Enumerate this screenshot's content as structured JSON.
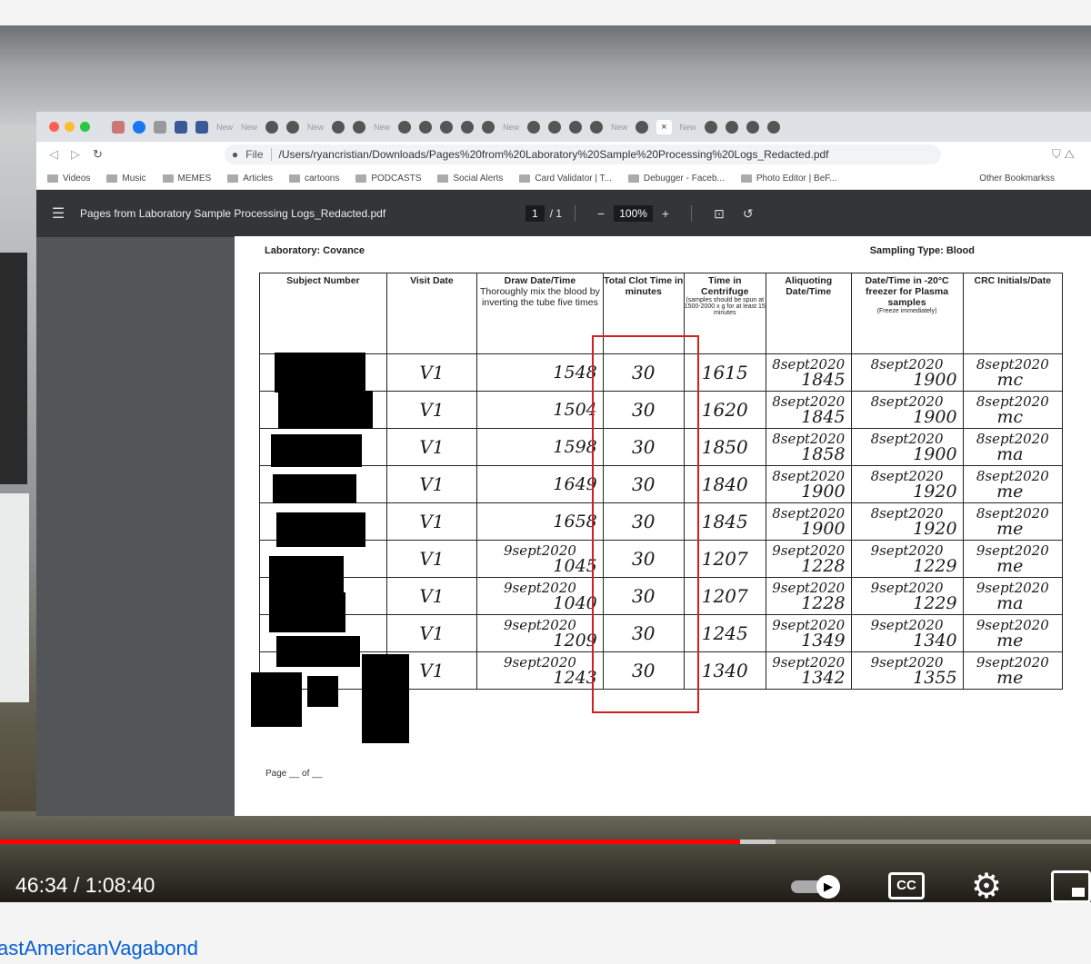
{
  "browser": {
    "active_tab_close": "×",
    "new_tab_label": "New",
    "url_scheme": "File",
    "url": "/Users/ryancristian/Downloads/Pages%20from%20Laboratory%20Sample%20Processing%20Logs_Redacted.pdf",
    "bookmarks": [
      "Videos",
      "Music",
      "MEMES",
      "Articles",
      "cartoons",
      "PODCASTS",
      "Social Alerts",
      "Card Validator | T...",
      "Debugger - Faceb...",
      "Photo Editor | BeF..."
    ],
    "other_bookmarks": "Other Bookmarkss"
  },
  "pdf": {
    "title": "Pages from Laboratory Sample Processing Logs_Redacted.pdf",
    "page_current": "1",
    "page_total": "/ 1",
    "zoom": "100%"
  },
  "doc": {
    "laboratory": "Laboratory: Covance",
    "sampling_type": "Sampling Type: Blood",
    "footer": "Page __ of __",
    "headers": {
      "subject": "Subject Number",
      "visit": "Visit Date",
      "draw": "Draw Date/Time",
      "draw_sub": "Thoroughly mix the blood by inverting the tube five times",
      "clot": "Total Clot Time in minutes",
      "centrifuge": "Time in Centrifuge",
      "centrifuge_sub": "(samples should be spun at 1500-2000 x g for at least 15 minutes",
      "aliquot": "Aliquoting Date/Time",
      "freezer": "Date/Time in -20°C freezer for Plasma samples",
      "freezer_sub": "(Freeze immediately)",
      "crc": "CRC Initials/Date"
    },
    "rows": [
      {
        "visit": "V1",
        "draw_date": "",
        "draw_time": "1548",
        "clot": "30",
        "centrifuge": "1615",
        "aliquot_date": "8sept2020",
        "aliquot_time": "1845",
        "freezer_date": "8sept2020",
        "freezer_time": "1900",
        "crc_date": "8sept2020",
        "crc_init": "mc"
      },
      {
        "visit": "V1",
        "draw_date": "",
        "draw_time": "1504",
        "clot": "30",
        "centrifuge": "1620",
        "aliquot_date": "8sept2020",
        "aliquot_time": "1845",
        "freezer_date": "8sept2020",
        "freezer_time": "1900",
        "crc_date": "8sept2020",
        "crc_init": "mc"
      },
      {
        "visit": "V1",
        "draw_date": "",
        "draw_time": "1598",
        "clot": "30",
        "centrifuge": "1850",
        "aliquot_date": "8sept2020",
        "aliquot_time": "1858",
        "freezer_date": "8sept2020",
        "freezer_time": "1900",
        "crc_date": "8sept2020",
        "crc_init": "ma"
      },
      {
        "visit": "V1",
        "draw_date": "",
        "draw_time": "1649",
        "clot": "30",
        "centrifuge": "1840",
        "aliquot_date": "8sept2020",
        "aliquot_time": "1900",
        "freezer_date": "8sept2020",
        "freezer_time": "1920",
        "crc_date": "8sept2020",
        "crc_init": "me"
      },
      {
        "visit": "V1",
        "draw_date": "",
        "draw_time": "1658",
        "clot": "30",
        "centrifuge": "1845",
        "aliquot_date": "8sept2020",
        "aliquot_time": "1900",
        "freezer_date": "8sept2020",
        "freezer_time": "1920",
        "crc_date": "8sept2020",
        "crc_init": "me"
      },
      {
        "visit": "V1",
        "draw_date": "9sept2020",
        "draw_time": "1045",
        "clot": "30",
        "centrifuge": "1207",
        "aliquot_date": "9sept2020",
        "aliquot_time": "1228",
        "freezer_date": "9sept2020",
        "freezer_time": "1229",
        "crc_date": "9sept2020",
        "crc_init": "me"
      },
      {
        "visit": "V1",
        "draw_date": "9sept2020",
        "draw_time": "1040",
        "clot": "30",
        "centrifuge": "1207",
        "aliquot_date": "9sept2020",
        "aliquot_time": "1228",
        "freezer_date": "9sept2020",
        "freezer_time": "1229",
        "crc_date": "9sept2020",
        "crc_init": "ma"
      },
      {
        "visit": "V1",
        "draw_date": "9sept2020",
        "draw_time": "1209",
        "clot": "30",
        "centrifuge": "1245",
        "aliquot_date": "9sept2020",
        "aliquot_time": "1349",
        "freezer_date": "9sept2020",
        "freezer_time": "1340",
        "crc_date": "9sept2020",
        "crc_init": "me"
      },
      {
        "visit": "V1",
        "draw_date": "9sept2020",
        "draw_time": "1243",
        "clot": "30",
        "centrifuge": "1340",
        "aliquot_date": "9sept2020",
        "aliquot_time": "1342",
        "freezer_date": "9sept2020",
        "freezer_time": "1355",
        "crc_date": "9sept2020",
        "crc_init": "me"
      }
    ]
  },
  "player": {
    "time_current": "46:34",
    "time_separator": "/",
    "time_total": "1:08:40",
    "progress_played": 0.678,
    "progress_buffered": 0.711,
    "cc_label": "CC",
    "icons": [
      "autoplay-toggle-icon",
      "cc-icon",
      "settings-icon",
      "miniplayer-icon"
    ]
  },
  "channel": {
    "name": "astAmericanVagabond"
  },
  "colors": {
    "progress": "#ff0000",
    "highlight_box": "#d21f1f",
    "channel_link": "#065fd4"
  }
}
